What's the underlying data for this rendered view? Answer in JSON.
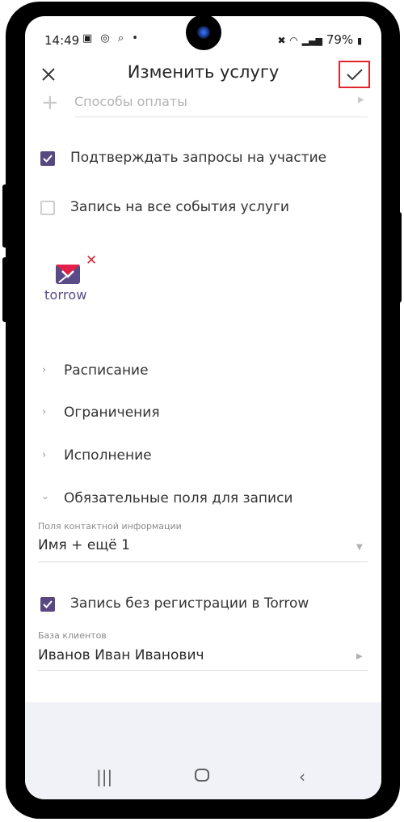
{
  "status": {
    "time": "14:49",
    "left_icons": "▣ ◎ ⌕ •",
    "right_text": "79%"
  },
  "toolbar": {
    "title": "Изменить услугу"
  },
  "payment": {
    "label": "Способы оплаты"
  },
  "checkboxes": [
    {
      "label": "Подтверждать запросы на участие",
      "checked": true
    },
    {
      "label": "Запись на все события услуги",
      "checked": false
    }
  ],
  "logo": {
    "text": "torrow",
    "brand_color": "#5a4b86",
    "accent_color": "#e4204a"
  },
  "sections": [
    {
      "label": "Расписание",
      "expanded": false
    },
    {
      "label": "Ограничения",
      "expanded": false
    },
    {
      "label": "Исполнение",
      "expanded": false
    },
    {
      "label": "Обязательные поля для записи",
      "expanded": true
    }
  ],
  "contact_fields": {
    "label": "Поля контактной информации",
    "value": "Имя + ещё 1"
  },
  "no_registration": {
    "label": "Запись без регистрации в Torrow",
    "checked": true
  },
  "client_base": {
    "label": "База клиентов",
    "value": "Иванов Иван Иванович"
  },
  "colors": {
    "checkbox_accent": "#57487f",
    "highlight": "#e0252d"
  }
}
